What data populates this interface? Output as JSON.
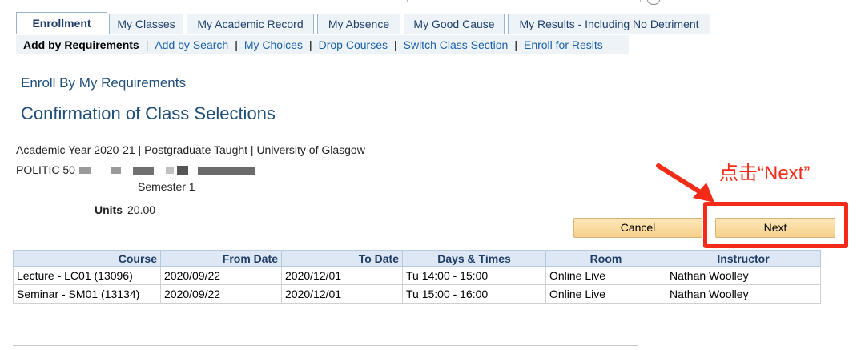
{
  "tabs": [
    {
      "label": "Enrollment"
    },
    {
      "label": "My Classes"
    },
    {
      "label": "My Academic Record"
    },
    {
      "label": "My Absence"
    },
    {
      "label": "My Good Cause"
    },
    {
      "label": "My Results - Including No Detriment"
    }
  ],
  "subnav": {
    "current": "Add by Requirements",
    "links": [
      "Add by Search",
      "My Choices",
      "Drop Courses",
      "Switch Class Section",
      "Enroll for Resits"
    ]
  },
  "section_title": "Enroll By My Requirements",
  "page_title": "Confirmation of Class Selections",
  "info": {
    "academic_line": "Academic Year 2020-21 | Postgraduate Taught | University of Glasgow",
    "course_code": "POLITIC 50",
    "semester": "Semester 1",
    "units_label": "Units",
    "units_value": "20.00"
  },
  "buttons": {
    "cancel": "Cancel",
    "next": "Next"
  },
  "annotation": "点击“Next”",
  "table": {
    "headers": [
      "Course",
      "From Date",
      "To Date",
      "Days & Times",
      "Room",
      "Instructor"
    ],
    "rows": [
      [
        "Lecture - LC01 (13096)",
        "2020/09/22",
        "2020/12/01",
        "Tu 14:00 - 15:00",
        "Online Live",
        "Nathan Woolley"
      ],
      [
        "Seminar - SM01 (13134)",
        "2020/09/22",
        "2020/12/01",
        "Tu 15:00 - 16:00",
        "Online Live",
        "Nathan Woolley"
      ]
    ]
  },
  "colors": {
    "accent": "#1f4e79",
    "annotation": "#f32b18",
    "button": "#f6d08c"
  }
}
